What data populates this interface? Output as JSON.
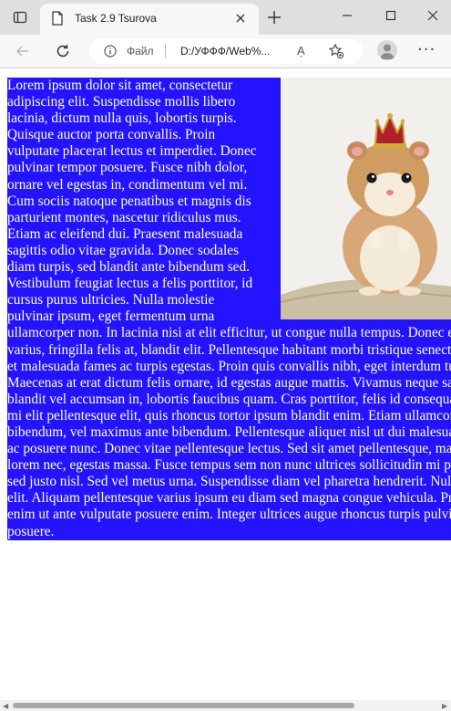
{
  "browser": {
    "tab": {
      "title": "Task 2.9 Tsurova"
    },
    "address": {
      "scheme_label": "Файл",
      "url": "D:/УФФФ/Web%..."
    },
    "read_aloud_label": "A̩",
    "icons": {
      "tab_actions": "tab-actions-icon",
      "page": "page-icon",
      "close": "close-icon",
      "new_tab": "plus-icon",
      "minimize": "minimize-icon",
      "maximize": "maximize-icon",
      "close_window": "close-window-icon",
      "back": "back-arrow-icon",
      "refresh": "refresh-icon",
      "info": "info-icon",
      "favorites": "add-favorite-icon",
      "profile": "profile-avatar-icon",
      "more": "more-icon"
    }
  },
  "page": {
    "background_color": "#2413ff",
    "text_color": "#ffffff",
    "text": "Lorem ipsum dolor sit amet, consectetur adipiscing elit. Suspendisse mollis libero lacinia, dictum nulla quis, lobortis turpis. Quisque auctor porta convallis. Proin vulputate placerat lectus et imperdiet. Donec pulvinar tempor posuere. Fusce nibh dolor, ornare vel egestas in, condimentum vel mi. Cum sociis natoque penatibus et magnis dis parturient montes, nascetur ridiculus mus. Etiam ac eleifend dui. Praesent malesuada sagittis odio vitae gravida. Donec sodales diam turpis, sed blandit ante bibendum sed. Vestibulum feugiat lectus a felis porttitor, id cursus purus ultricies. Nulla molestie pulvinar ipsum, eget fermentum urna ullamcorper non. In lacinia nisi at elit efficitur, ut congue nulla tempus. Donec et urna varius, fringilla felis at, blandit elit. Pellentesque habitant morbi tristique senectus et netus et malesuada fames ac turpis egestas. Proin quis convallis nibh, eget interdum turpis. Maecenas at erat dictum felis ornare, id egestas augue mattis. Vivamus neque sapien, blandit vel accumsan in, lobortis faucibus quam. Cras porttitor, felis id consequat rhoncus, mi elit pellentesque elit, quis rhoncus tortor ipsum blandit enim. Etiam ullamcorper lectus bibendum, vel maximus ante bibendum. Pellentesque aliquet nisl ut dui malesuada. Morbi ac posuere nunc. Donec vitae pellentesque lectus. Sed sit amet pellentesque, maximus lorem nec, egestas massa. Fusce tempus sem non nunc ultrices sollicitudin mi porttitor. Ut sed justo nisl. Sed vel metus urna. Suspendisse diam vel pharetra hendrerit. Nulla ut justo elit. Aliquam pellentesque varius ipsum eu diam sed magna congue vehicula. Praesent eu enim ut ante vulputate posuere enim. Integer ultrices augue rhoncus turpis pulvinar posuere.",
    "image": {
      "subject": "hamster-with-crown"
    }
  }
}
